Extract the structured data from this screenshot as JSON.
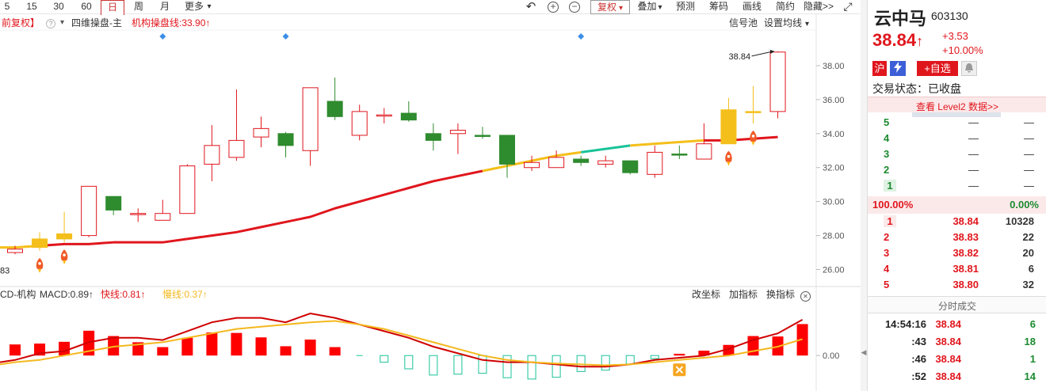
{
  "toolbar": {
    "periods": [
      "5",
      "15",
      "30",
      "60",
      "日",
      "周",
      "月",
      "更多"
    ],
    "active_period": "日",
    "more_caret": "▾",
    "undo": "↶",
    "zoom_in": "+",
    "zoom_out": "−",
    "fuquan": "复权",
    "fuquan_caret": "▾",
    "diejia": "叠加",
    "diejia_caret": "▾",
    "yuce": "预测",
    "chouma": "筹码",
    "huaxian": "画线",
    "jianyue": "简约",
    "yincang": "隐藏>>",
    "fullscreen": "⤢"
  },
  "info_row": {
    "qianfuquan": "前复权】",
    "help": "?",
    "indicator_caret": "▾",
    "indicator_name": "四维操盘-主",
    "jigou_label": "机构操盘线:33.90",
    "jigou_arrow": "↑",
    "xinhaochi": "信号池",
    "shezhi": "设置均线",
    "shezhi_caret": "▾"
  },
  "macd_row": {
    "name": "CD-机构",
    "macd": "MACD:0.89",
    "macd_arrow": "↑",
    "kuaixian": "快线:0.81",
    "kuaixian_arrow": "↑",
    "manxian": "慢线:0.37",
    "manxian_arrow": "↑",
    "gaizuobiao": "改坐标",
    "jiazhibiao": "加指标",
    "huanzhibiao": "换指标",
    "close": "✕"
  },
  "chart_data": {
    "type": "candlestick",
    "y_ticks": [
      "38.00",
      "36.00",
      "34.00",
      "32.00",
      "30.00",
      "28.00",
      "26.00"
    ],
    "y_tick_values": [
      38,
      36,
      34,
      32,
      30,
      28,
      26
    ],
    "ylim": [
      25.0,
      40.0
    ],
    "last_price_label": "38.84",
    "left_price_label": "83",
    "macd_zero_label": "0.00",
    "candles": [
      {
        "o": 27.0,
        "c": 27.2,
        "h": 27.4,
        "l": 26.9,
        "color": "red"
      },
      {
        "o": 27.3,
        "c": 27.8,
        "h": 28.2,
        "l": 27.1,
        "color": "yellow"
      },
      {
        "o": 27.8,
        "c": 28.1,
        "h": 29.4,
        "l": 27.6,
        "color": "yellow"
      },
      {
        "o": 28.0,
        "c": 30.9,
        "h": 30.9,
        "l": 27.9,
        "color": "red"
      },
      {
        "o": 30.3,
        "c": 29.5,
        "h": 30.3,
        "l": 29.2,
        "color": "green"
      },
      {
        "o": 29.3,
        "c": 29.3,
        "h": 29.6,
        "l": 28.8,
        "color": "red"
      },
      {
        "o": 28.9,
        "c": 29.3,
        "h": 30.1,
        "l": 28.9,
        "color": "red"
      },
      {
        "o": 29.3,
        "c": 32.1,
        "h": 32.2,
        "l": 29.3,
        "color": "red"
      },
      {
        "o": 32.2,
        "c": 33.3,
        "h": 34.5,
        "l": 31.2,
        "color": "red"
      },
      {
        "o": 32.6,
        "c": 33.6,
        "h": 36.6,
        "l": 32.4,
        "color": "red"
      },
      {
        "o": 33.8,
        "c": 34.3,
        "h": 35.0,
        "l": 33.2,
        "color": "red"
      },
      {
        "o": 34.0,
        "c": 33.3,
        "h": 34.1,
        "l": 32.6,
        "color": "green"
      },
      {
        "o": 33.0,
        "c": 36.7,
        "h": 36.7,
        "l": 32.1,
        "color": "red"
      },
      {
        "o": 35.9,
        "c": 35.0,
        "h": 37.3,
        "l": 34.8,
        "color": "green"
      },
      {
        "o": 33.9,
        "c": 35.3,
        "h": 35.7,
        "l": 33.6,
        "color": "red"
      },
      {
        "o": 35.1,
        "c": 35.1,
        "h": 35.5,
        "l": 34.6,
        "color": "red"
      },
      {
        "o": 35.2,
        "c": 34.8,
        "h": 35.9,
        "l": 34.7,
        "color": "green"
      },
      {
        "o": 34.0,
        "c": 33.6,
        "h": 34.6,
        "l": 33.0,
        "color": "green"
      },
      {
        "o": 34.0,
        "c": 34.2,
        "h": 34.6,
        "l": 32.8,
        "color": "red"
      },
      {
        "o": 33.9,
        "c": 33.9,
        "h": 34.4,
        "l": 33.7,
        "color": "green"
      },
      {
        "o": 33.9,
        "c": 32.2,
        "h": 33.9,
        "l": 31.4,
        "color": "green"
      },
      {
        "o": 32.0,
        "c": 32.3,
        "h": 32.7,
        "l": 31.8,
        "color": "red"
      },
      {
        "o": 32.0,
        "c": 32.6,
        "h": 33.0,
        "l": 32.0,
        "color": "red"
      },
      {
        "o": 32.5,
        "c": 32.3,
        "h": 32.7,
        "l": 32.1,
        "color": "green"
      },
      {
        "o": 32.2,
        "c": 32.4,
        "h": 32.7,
        "l": 32.0,
        "color": "red"
      },
      {
        "o": 32.4,
        "c": 31.7,
        "h": 32.4,
        "l": 31.6,
        "color": "green"
      },
      {
        "o": 31.6,
        "c": 32.9,
        "h": 33.3,
        "l": 31.4,
        "color": "red"
      },
      {
        "o": 32.8,
        "c": 32.8,
        "h": 33.3,
        "l": 32.5,
        "color": "green"
      },
      {
        "o": 32.5,
        "c": 33.4,
        "h": 34.6,
        "l": 32.5,
        "color": "red"
      },
      {
        "o": 33.4,
        "c": 35.4,
        "h": 36.1,
        "l": 33.4,
        "color": "yellow"
      },
      {
        "o": 35.3,
        "c": 35.3,
        "h": 36.8,
        "l": 34.6,
        "color": "yellow"
      },
      {
        "o": 35.3,
        "c": 38.8,
        "h": 38.84,
        "l": 34.9,
        "color": "red"
      }
    ],
    "ma_line": [
      27.3,
      27.4,
      27.5,
      27.5,
      27.6,
      27.6,
      27.6,
      27.8,
      28.0,
      28.2,
      28.5,
      28.8,
      29.1,
      29.6,
      30.0,
      30.4,
      30.8,
      31.2,
      31.5,
      31.8,
      32.1,
      32.4,
      32.7,
      32.9,
      33.1,
      33.3,
      33.4,
      33.5,
      33.6,
      33.6,
      33.7,
      33.8,
      33.9
    ],
    "ma_segments": [
      {
        "from": 0,
        "to": 1,
        "color": "yellow"
      },
      {
        "from": 1,
        "to": 19,
        "color": "red"
      },
      {
        "from": 19,
        "to": 23,
        "color": "yellow"
      },
      {
        "from": 23,
        "to": 25,
        "color": "teal"
      },
      {
        "from": 25,
        "to": 28,
        "color": "yellow"
      },
      {
        "from": 28,
        "to": 31,
        "color": "red"
      }
    ],
    "macd_hist": [
      0.25,
      0.27,
      0.31,
      0.56,
      0.44,
      0.3,
      0.19,
      0.4,
      0.52,
      0.51,
      0.41,
      0.21,
      0.36,
      0.19,
      0.0,
      -0.15,
      -0.3,
      -0.44,
      -0.42,
      -0.4,
      -0.5,
      -0.53,
      -0.49,
      -0.36,
      -0.33,
      -0.19,
      -0.07,
      0.04,
      0.11,
      0.24,
      0.44,
      0.43,
      0.71
    ],
    "macd_fast": [
      -0.1,
      0.05,
      0.1,
      0.3,
      0.4,
      0.4,
      0.35,
      0.55,
      0.75,
      0.85,
      0.85,
      0.75,
      0.95,
      0.85,
      0.7,
      0.55,
      0.4,
      0.2,
      0.05,
      -0.1,
      -0.15,
      -0.15,
      -0.2,
      -0.25,
      -0.25,
      -0.2,
      -0.1,
      -0.05,
      0.0,
      0.15,
      0.35,
      0.5,
      0.81
    ],
    "macd_slow": [
      -0.15,
      -0.1,
      0.0,
      0.1,
      0.2,
      0.25,
      0.3,
      0.4,
      0.5,
      0.6,
      0.65,
      0.7,
      0.75,
      0.78,
      0.7,
      0.6,
      0.45,
      0.3,
      0.15,
      0.0,
      -0.1,
      -0.15,
      -0.18,
      -0.2,
      -0.22,
      -0.2,
      -0.15,
      -0.1,
      -0.05,
      0.0,
      0.1,
      0.2,
      0.37
    ],
    "macd_ylim": [
      -0.8,
      1.2
    ],
    "rocket_markers": [
      1,
      2,
      29,
      30
    ],
    "diamond_markers": [
      6,
      11,
      23
    ],
    "x_marker": 27,
    "colors": {
      "red": "#e0161d",
      "green": "#2e8b2e",
      "yellow": "#f4bf1a",
      "teal": "#19c398",
      "macd_slow": "#f4b81f",
      "macd_fast": "#d00000"
    }
  },
  "quote": {
    "name": "云中马",
    "code": "603130",
    "price": "38.84",
    "price_arrow": "↑",
    "change": "+3.53",
    "change_pct": "+10.00%",
    "badge_hu": "沪",
    "badge_zixuan": "+自选",
    "status_label": "交易状态：已收盘",
    "level2": "查看 Level2 数据>>",
    "sell_levels": [
      {
        "level": "5",
        "price": "—",
        "vol": "—"
      },
      {
        "level": "4",
        "price": "—",
        "vol": "—"
      },
      {
        "level": "3",
        "price": "—",
        "vol": "—"
      },
      {
        "level": "2",
        "price": "—",
        "vol": "—"
      },
      {
        "level": "1",
        "price": "—",
        "vol": "—"
      }
    ],
    "ratio_left": "100.00%",
    "ratio_right": "0.00%",
    "buy_levels": [
      {
        "level": "1",
        "price": "38.84",
        "vol": "10328"
      },
      {
        "level": "2",
        "price": "38.83",
        "vol": "22"
      },
      {
        "level": "3",
        "price": "38.82",
        "vol": "20"
      },
      {
        "level": "4",
        "price": "38.81",
        "vol": "6"
      },
      {
        "level": "5",
        "price": "38.80",
        "vol": "32"
      }
    ],
    "trades_title": "分时成交",
    "trades": [
      {
        "time": "14:54:16",
        "price": "38.84",
        "vol": "6"
      },
      {
        "time": ":43",
        "price": "38.84",
        "vol": "18"
      },
      {
        "time": ":46",
        "price": "38.84",
        "vol": "1"
      },
      {
        "time": ":52",
        "price": "38.84",
        "vol": "14"
      }
    ]
  }
}
